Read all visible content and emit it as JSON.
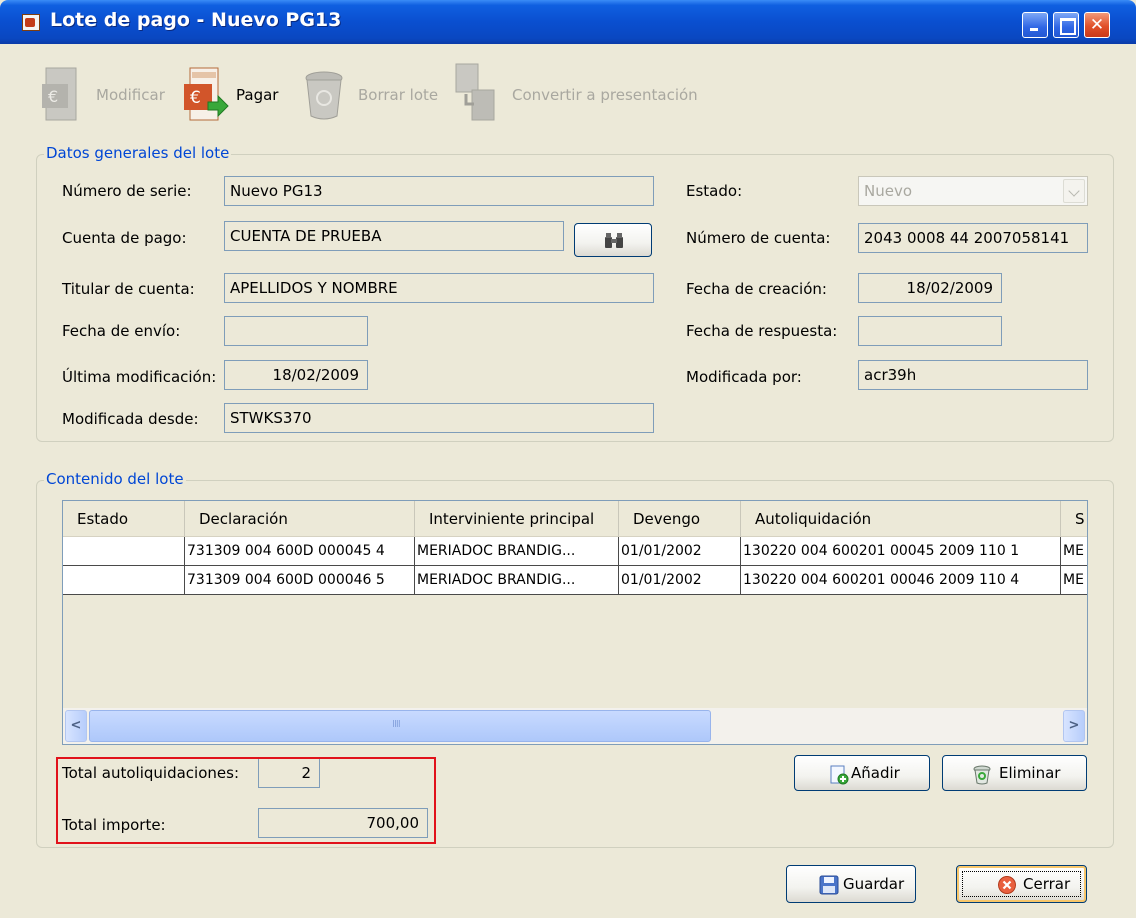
{
  "window": {
    "title": "Lote de pago  - Nuevo PG13"
  },
  "toolbar": {
    "modificar": "Modificar",
    "pagar": "Pagar",
    "borrar": "Borrar lote",
    "convertir": "Convertir a presentación"
  },
  "general": {
    "legend": "Datos generales del lote",
    "numero_serie_label": "Número de serie:",
    "numero_serie_value": "Nuevo PG13",
    "cuenta_pago_label": "Cuenta de pago:",
    "cuenta_pago_value": "CUENTA DE PRUEBA",
    "titular_label": "Titular de cuenta:",
    "titular_value": "APELLIDOS Y NOMBRE",
    "fecha_envio_label": "Fecha de envío:",
    "fecha_envio_value": "",
    "ultima_mod_label": "Última modificación:",
    "ultima_mod_value": "18/02/2009",
    "mod_desde_label": "Modificada desde:",
    "mod_desde_value": "STWKS370",
    "estado_label": "Estado:",
    "estado_value": "Nuevo",
    "numero_cuenta_label": "Número de cuenta:",
    "numero_cuenta_value": "2043 0008 44 2007058141",
    "fecha_creacion_label": "Fecha de creación:",
    "fecha_creacion_value": "18/02/2009",
    "fecha_respuesta_label": "Fecha de respuesta:",
    "fecha_respuesta_value": "",
    "mod_por_label": "Modificada por:",
    "mod_por_value": "acr39h"
  },
  "contenido": {
    "legend": "Contenido del lote",
    "columns": [
      "Estado",
      "Declaración",
      "Interviniente principal",
      "Devengo",
      "Autoliquidación",
      "S"
    ],
    "rows": [
      [
        "",
        "731309 004 600D 000045 4",
        "MERIADOC BRANDIG...",
        "01/01/2002",
        "130220 004 600201 00045 2009 110 1",
        "ME"
      ],
      [
        "",
        "731309 004 600D 000046 5",
        "MERIADOC BRANDIG...",
        "01/01/2002",
        "130220 004 600201 00046 2009 110 4",
        "ME"
      ]
    ],
    "total_autoliq_label": "Total autoliquidaciones:",
    "total_autoliq_value": "2",
    "total_importe_label": "Total importe:",
    "total_importe_value": "700,00",
    "anadir": "Añadir",
    "eliminar": "Eliminar"
  },
  "footer": {
    "guardar": "Guardar",
    "cerrar": "Cerrar"
  },
  "icons": {
    "title": "document-euro-icon",
    "modificar": "document-edit-icon",
    "pagar": "pay-document-icon",
    "borrar": "trash-icon",
    "convertir": "convert-icon",
    "buscar": "binoculars-icon",
    "anadir": "add-document-icon",
    "eliminar": "trash-icon",
    "guardar": "floppy-disk-icon",
    "cerrar": "close-circle-icon"
  },
  "colors": {
    "titlebar": "#0a4fd0",
    "legend": "#0046d5",
    "highlight": "#e1121b"
  }
}
